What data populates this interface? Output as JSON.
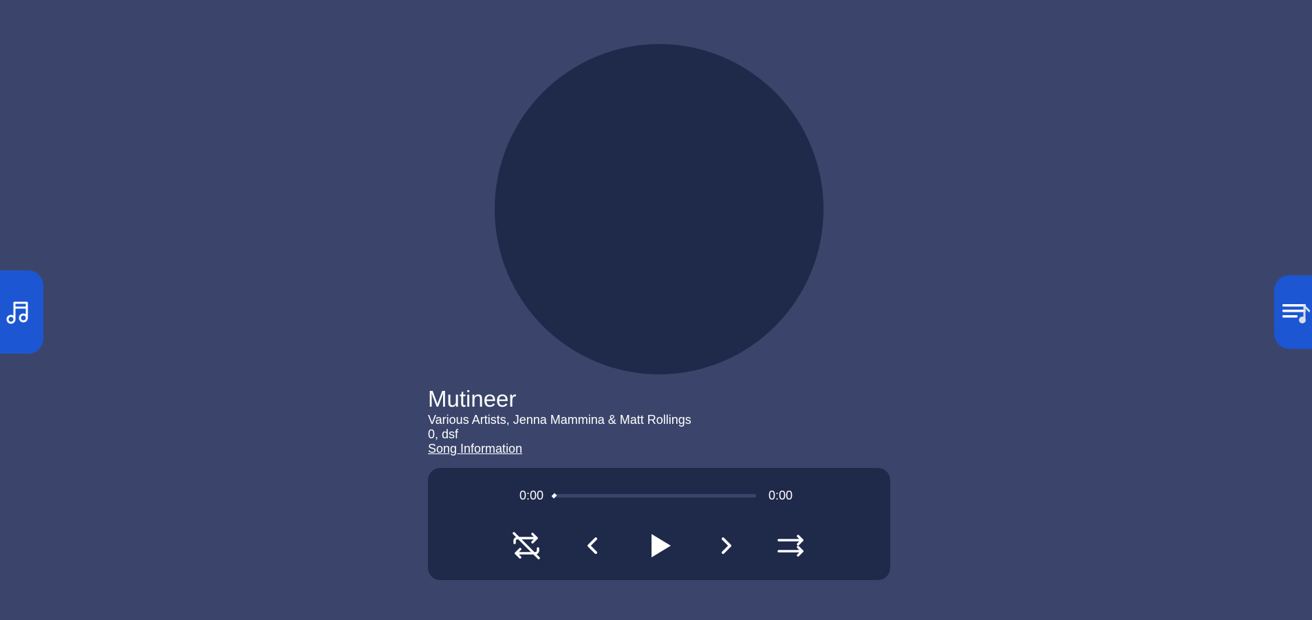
{
  "library_tab": {
    "icon": "music-note-icon"
  },
  "queue_tab": {
    "icon": "queue-music-icon"
  },
  "album_art": {
    "color": "#1f294a"
  },
  "song": {
    "title": "Mutineer",
    "artist": "Various Artists, Jenna Mammina & Matt Rollings",
    "meta": "0, dsf",
    "info_link": "Song Information"
  },
  "player": {
    "current_time": "0:00",
    "total_time": "0:00",
    "progress": 0,
    "buttons": {
      "repeat": "repeat-off-icon",
      "previous": "previous-icon",
      "play": "play-icon",
      "next": "next-icon",
      "shuffle": "shuffle-icon"
    }
  },
  "colors": {
    "background": "#3b456b",
    "panel": "#1f294a",
    "accent": "#1c56d2",
    "text": "#ffffff"
  }
}
